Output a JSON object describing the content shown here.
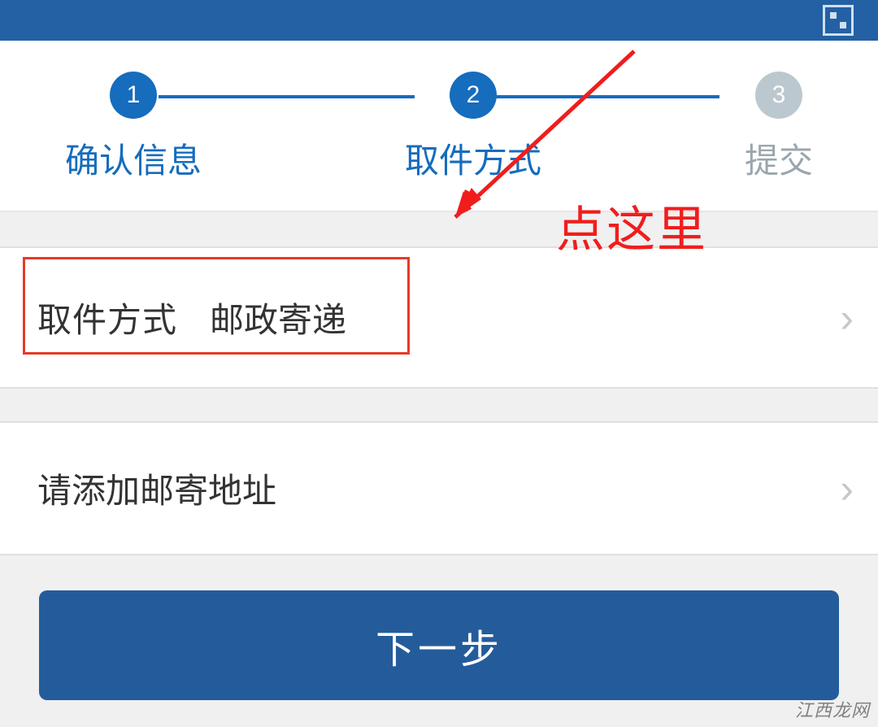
{
  "steps": {
    "items": [
      {
        "num": "1",
        "label": "确认信息"
      },
      {
        "num": "2",
        "label": "取件方式"
      },
      {
        "num": "3",
        "label": "提交"
      }
    ]
  },
  "pickup_row": {
    "label": "取件方式",
    "value": "邮政寄递"
  },
  "address_row": {
    "placeholder": "请添加邮寄地址"
  },
  "next_button": {
    "label": "下一步"
  },
  "annotation": {
    "text": "点这里"
  },
  "watermark": "江西龙网"
}
